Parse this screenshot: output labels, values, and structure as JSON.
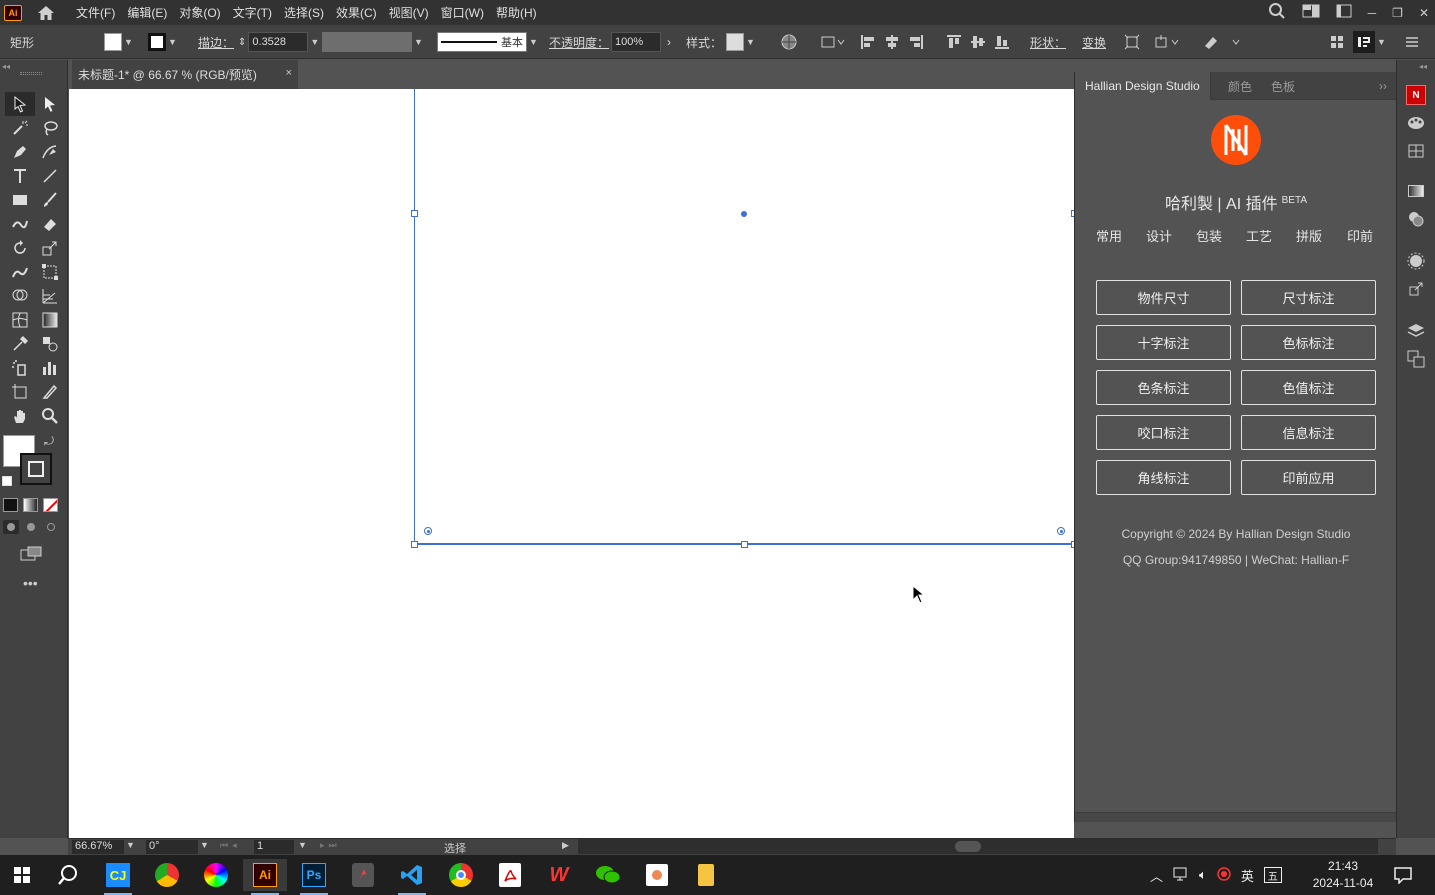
{
  "app": {
    "logo_text": "Ai"
  },
  "menu": [
    "文件(F)",
    "编辑(E)",
    "对象(O)",
    "文字(T)",
    "选择(S)",
    "效果(C)",
    "视图(V)",
    "窗口(W)",
    "帮助(H)"
  ],
  "control_bar": {
    "object_type": "矩形",
    "stroke_label": "描边：",
    "stroke_value": "0.3528",
    "line_style": "基本",
    "opacity_label": "不透明度：",
    "opacity_value": "100%",
    "style_label": "样式：",
    "shape_label": "形状：",
    "transform_label": "变换"
  },
  "document_tab": {
    "title": "未标题-1* @ 66.67 % (RGB/预览)",
    "close": "×"
  },
  "plugin_panel": {
    "tabs": [
      "Hallian Design Studio",
      "颜色",
      "色板"
    ],
    "collapse": "››",
    "logo_text": "N",
    "title": "哈利製 | AI 插件",
    "badge": "BETA",
    "categories": [
      "常用",
      "设计",
      "包装",
      "工艺",
      "拼版",
      "印前"
    ],
    "buttons": [
      "物件尺寸",
      "尺寸标注",
      "十字标注",
      "色标标注",
      "色条标注",
      "色值标注",
      "咬口标注",
      "信息标注",
      "角线标注",
      "印前应用"
    ],
    "copyright": "Copyright © 2024 By Hallian Design Studio",
    "contact": "QQ Group:941749850 | WeChat: Hallian-F"
  },
  "status_bar": {
    "zoom": "66.67%",
    "rotation": "0°",
    "artboard": "1",
    "tool": "选择"
  },
  "taskbar": {
    "apps": [
      "search",
      "cnki",
      "chrome",
      "color-app",
      "illustrator",
      "photoshop",
      "axure",
      "vscode",
      "chromium",
      "acrobat",
      "wps",
      "wechat",
      "powerpoint",
      "notes"
    ],
    "ime": "英",
    "ime2": "五",
    "time": "21:43",
    "date": "2024-11-04"
  },
  "colors": {
    "accent": "#ff4e0a",
    "selection": "#3e6fd6"
  }
}
